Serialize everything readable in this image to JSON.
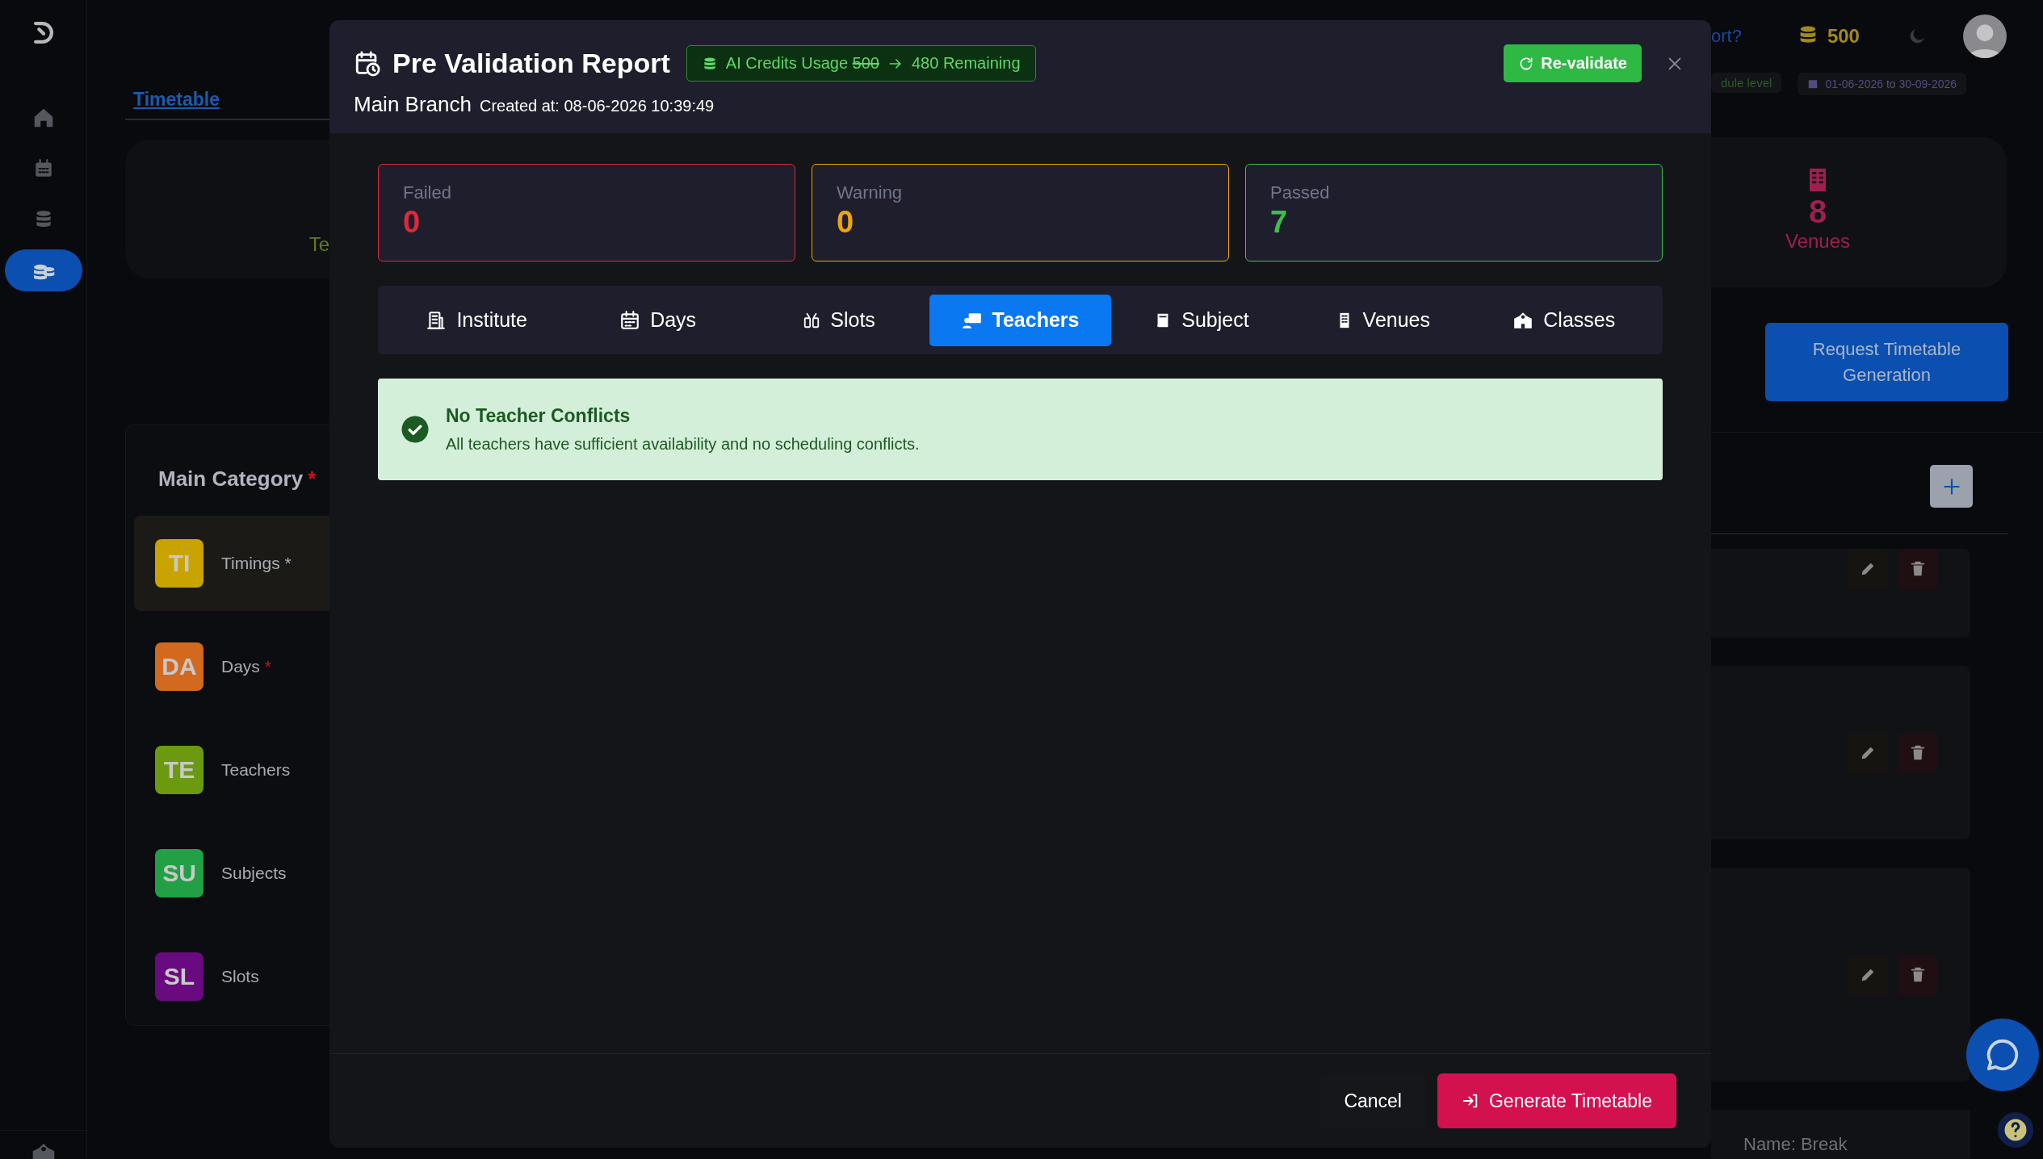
{
  "sidebar": {
    "items": [
      {
        "selected": false
      },
      {
        "selected": false
      },
      {
        "selected": false
      },
      {
        "selected": true
      }
    ]
  },
  "page": {
    "tabs": [
      {
        "label": "Timetable",
        "selected": true
      }
    ],
    "summary_fragment": "Te",
    "main_category": {
      "title": "Main Category",
      "required_mark": "*",
      "items": [
        {
          "badge": "TI",
          "label": "Timings *",
          "color": "#c9a400",
          "selected": true
        },
        {
          "badge": "DA",
          "label": "Days",
          "required_mark": "*",
          "color": "#d2691e",
          "selected": false
        },
        {
          "badge": "TE",
          "label": "Teachers",
          "color": "#6b9a10",
          "selected": false
        },
        {
          "badge": "SU",
          "label": "Subjects",
          "color": "#22a046",
          "selected": false
        },
        {
          "badge": "SL",
          "label": "Slots",
          "color": "#6a0a80",
          "selected": false
        }
      ]
    },
    "top_bar": {
      "link_fragment": "ort?",
      "credits": "500"
    },
    "schedule_fragment": "dule level",
    "date_range": "01-06-2026 to 30-09-2026",
    "venues_stat": {
      "value": "8",
      "label": "Venues"
    },
    "request_button": "Request Timetable Generation",
    "last_row_fragment": "Name:  Break"
  },
  "modal": {
    "title": "Pre Validation Report",
    "credits": {
      "label": "AI Credits Usage",
      "old": "500",
      "remaining": "480 Remaining"
    },
    "revalidate": "Re-validate",
    "branch": "Main Branch",
    "created": "Created at: 08-06-2026 10:39:49",
    "stats": [
      {
        "label": "Failed",
        "value": "0",
        "color": "#e0283a"
      },
      {
        "label": "Warning",
        "value": "0",
        "color": "#f0a500"
      },
      {
        "label": "Passed",
        "value": "7",
        "color": "#3cc04a"
      }
    ],
    "tabs": [
      {
        "label": "Institute",
        "selected": false
      },
      {
        "label": "Days",
        "selected": false
      },
      {
        "label": "Slots",
        "selected": false
      },
      {
        "label": "Teachers",
        "selected": true
      },
      {
        "label": "Subject",
        "selected": false
      },
      {
        "label": "Venues",
        "selected": false
      },
      {
        "label": "Classes",
        "selected": false
      }
    ],
    "alert": {
      "title": "No Teacher Conflicts",
      "message": "All teachers have sufficient availability and no scheduling conflicts."
    },
    "buttons": [
      {
        "label": "Cancel",
        "kind": "secondary"
      },
      {
        "label": "Generate Timetable",
        "kind": "primary"
      }
    ]
  }
}
